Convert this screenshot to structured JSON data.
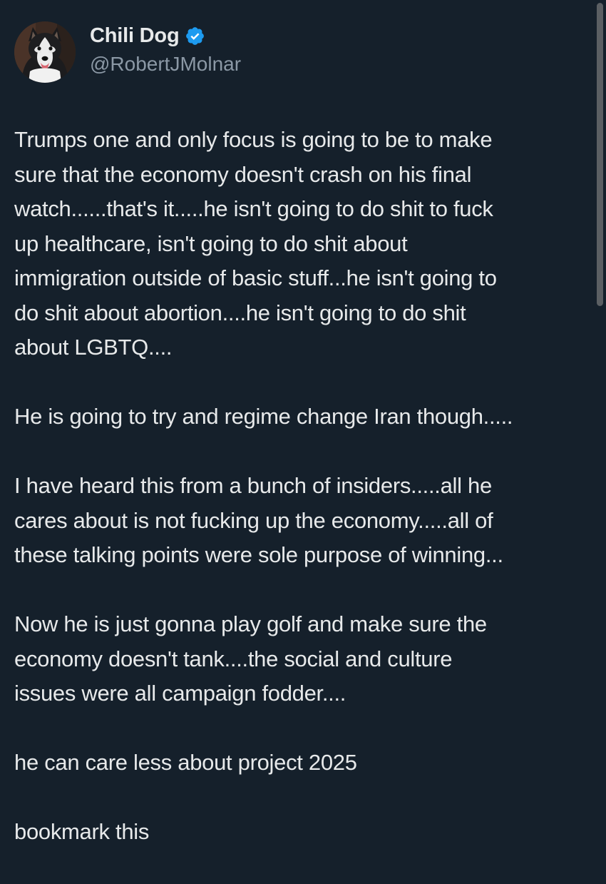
{
  "author": {
    "display_name": "Chili Dog",
    "handle": "@RobertJMolnar",
    "verified_icon": "verified-badge-icon",
    "avatar": "dog-avatar"
  },
  "tweet": {
    "paragraphs": [
      {
        "lines": [
          "Trumps one and only focus is going to be to make",
          "sure that the economy doesn't crash on his final",
          "watch......that's it.....he isn't going to do shit to fuck",
          "up healthcare, isn't going to do shit about",
          "immigration outside of basic stuff...he isn't going to",
          "do shit about abortion....he isn't going to do shit",
          "about LGBTQ...."
        ]
      },
      {
        "lines": [
          "He is going to try and regime change Iran though....."
        ]
      },
      {
        "lines": [
          "I have heard this from a bunch of insiders.....all he",
          "cares about is not fucking up the economy.....all of",
          "these talking points were sole purpose of winning..."
        ]
      },
      {
        "lines": [
          "Now he is just gonna play golf and make sure the",
          "economy doesn't tank....the social and culture",
          "issues were all campaign fodder...."
        ]
      },
      {
        "lines": [
          "he can care less about project 2025"
        ]
      },
      {
        "lines": [
          "bookmark this"
        ]
      }
    ]
  },
  "colors": {
    "background": "#15202b",
    "text_primary": "#e7e9ea",
    "text_secondary": "#8b98a5",
    "verified_blue": "#1d9bf0",
    "scrollbar": "#5b5f63"
  }
}
